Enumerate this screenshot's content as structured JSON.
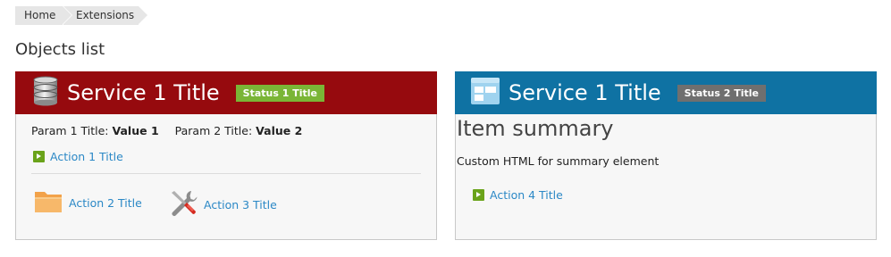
{
  "breadcrumb": {
    "home": "Home",
    "current": "Extensions"
  },
  "page_title": "Objects list",
  "cards": [
    {
      "title": "Service 1 Title",
      "status": "Status 1 Title",
      "status_color": "#7ab536",
      "header_color": "#960a0e",
      "icon": "database-icon",
      "params": [
        {
          "label": "Param 1 Title:",
          "value": "Value 1"
        },
        {
          "label": "Param 2 Title:",
          "value": "Value 2"
        }
      ],
      "actions": [
        {
          "label": "Action 1 Title",
          "icon": "play-icon"
        },
        {
          "label": "Action 2 Title",
          "icon": "folder-icon"
        },
        {
          "label": "Action 3 Title",
          "icon": "tools-icon"
        }
      ]
    },
    {
      "title": "Service 1 Title",
      "status": "Status 2 Title",
      "status_color": "#6f6f6f",
      "header_color": "#0f72a3",
      "icon": "dashboard-icon",
      "summary_title": "Item summary",
      "summary_text": "Custom HTML for summary element",
      "actions": [
        {
          "label": "Action 4 Title",
          "icon": "play-icon"
        }
      ]
    }
  ]
}
